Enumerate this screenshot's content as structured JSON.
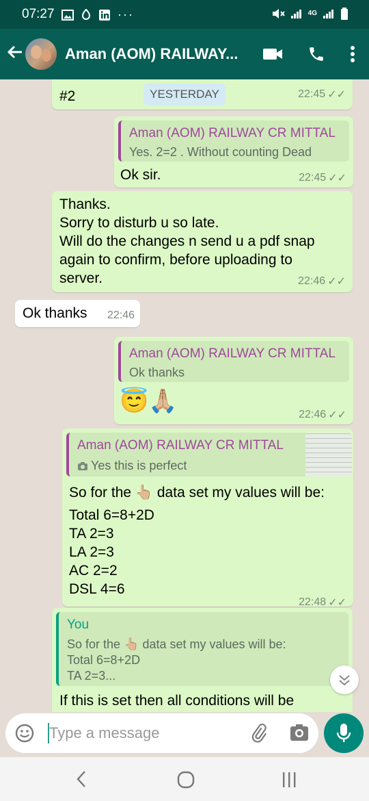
{
  "status_bar": {
    "time": "07:27",
    "network": "4G"
  },
  "header": {
    "title": "Aman (AOM) RAILWAY..."
  },
  "date_pill": "YESTERDAY",
  "messages": [
    {
      "text": "#2",
      "time": "22:45"
    },
    {
      "quote_name": "Aman (AOM) RAILWAY CR MITTAL",
      "quote_text": "Yes. 2=2 . Without counting Dead",
      "text": "Ok sir.",
      "time": "22:45"
    },
    {
      "lines": [
        "Thanks.",
        "Sorry to disturb u so late.",
        "Will do the changes n send u a pdf snap",
        "again to confirm, before uploading to",
        "server."
      ],
      "time": "22:46"
    },
    {
      "text": "Ok thanks",
      "time": "22:46"
    },
    {
      "quote_name": "Aman (AOM) RAILWAY CR MITTAL",
      "quote_text": "Ok thanks",
      "emoji": "😇🙏🏼",
      "time": "22:46"
    },
    {
      "quote_name": "Aman (AOM) RAILWAY CR MITTAL",
      "quote_text": "Yes this is perfect",
      "lines": [
        "So for the 👆🏼 data set my values will be:",
        "Total 6=8+2D",
        "TA 2=3",
        "LA 2=3",
        "AC 2=2",
        "DSL 4=6"
      ],
      "time": "22:48"
    },
    {
      "quote_name": "You",
      "quote_lines": [
        "So for the 👆🏼 data set my values will be:",
        "Total 6=8+2D",
        "TA 2=3..."
      ],
      "text": "If this is set then all conditions will be"
    }
  ],
  "composer": {
    "placeholder": "Type a message"
  },
  "colors": {
    "appbar": "#075e54",
    "statusbar": "#054d44",
    "outgoing": "#dcf8c6",
    "incoming": "#ffffff",
    "quote_accent": "#a0479b",
    "you_accent": "#07a081",
    "mic": "#00897b"
  }
}
